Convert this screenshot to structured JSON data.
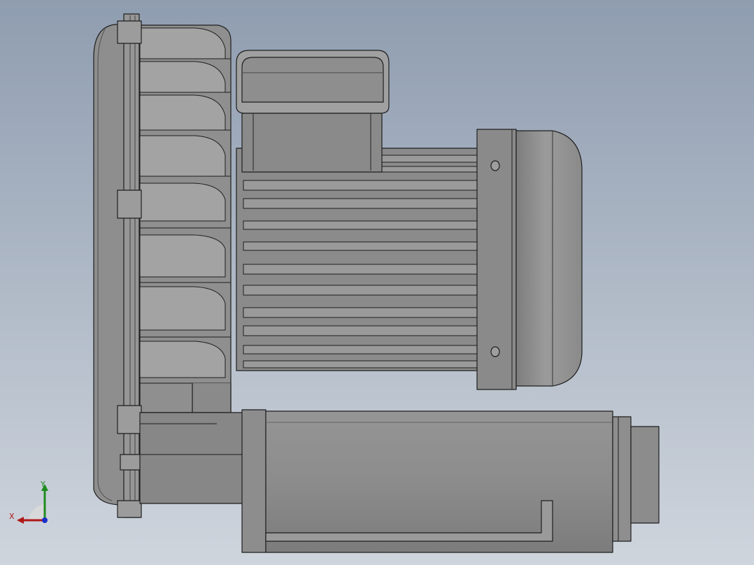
{
  "viewport": {
    "background_top": "#8f9db0",
    "background_bottom": "#cfd5dd"
  },
  "model": {
    "body_color": "#8c8c8c",
    "light_color": "#a6a6a6",
    "dark_color": "#6f6f6f",
    "edge_color": "#1e1e1e"
  },
  "triad": {
    "x_label": "X",
    "y_label": "Y",
    "x_color": "#b01818",
    "y_color": "#1e8c1e",
    "z_color": "#1a2fc8"
  }
}
